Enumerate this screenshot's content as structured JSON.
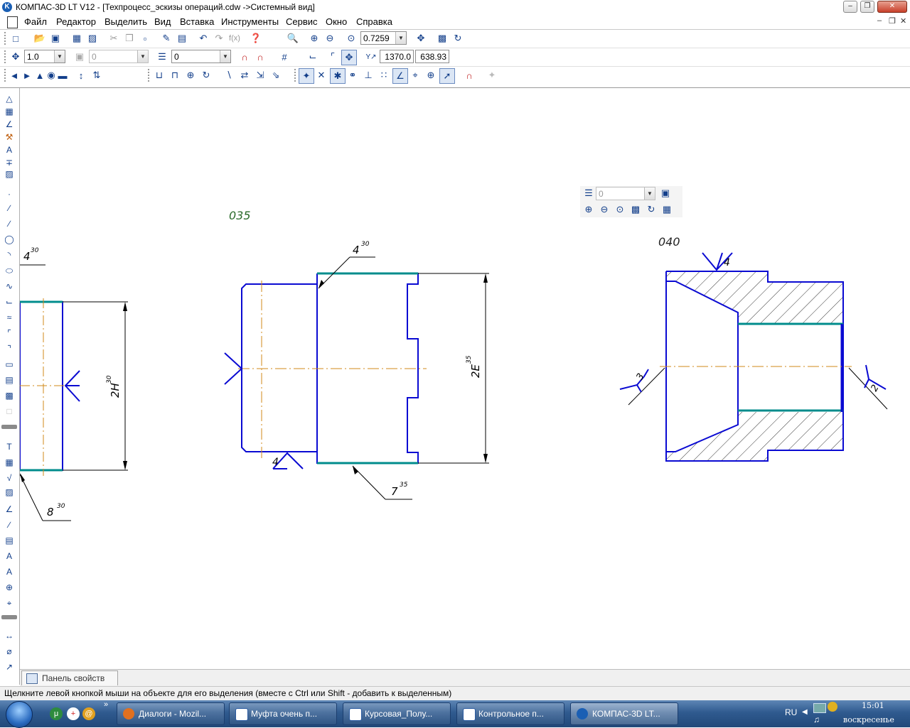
{
  "window": {
    "title": "КОМПАС-3D LT V12 - [Техпроцесс_эскизы операций.cdw ->Системный вид]",
    "app_icon": "K",
    "controls": [
      "minimize-icon",
      "restore-icon",
      "close-icon"
    ]
  },
  "menu": {
    "items": [
      "Файл",
      "Редактор",
      "Выделить",
      "Вид",
      "Вставка",
      "Инструменты",
      "Сервис",
      "Окно",
      "Справка"
    ]
  },
  "toolbar1": {
    "zoom_value": "0.7259"
  },
  "toolbar2": {
    "step_value": "1.0",
    "layer_value": "0",
    "style_value": "0",
    "coord_x": "1370.0",
    "coord_y": "638.93"
  },
  "float_panel": {
    "layer_value": "0"
  },
  "drawing": {
    "labels": {
      "op_035": "035",
      "op_040": "040",
      "left_rough": "4",
      "left_rough_sup": "30",
      "left_dim": "2Н",
      "left_dim_sup": "30",
      "left_leader": "8",
      "left_leader_sup": "30",
      "mid_top": "4",
      "mid_top_sup": "30",
      "mid_dim": "2Е",
      "mid_dim_sup": "35",
      "mid_bottom": "7",
      "mid_bottom_sup": "35",
      "mid_support": "4",
      "right_top": "4",
      "right_left": "3",
      "right_right": "2"
    },
    "colors": {
      "part": "#0a0ad2",
      "surface": "#008c8c",
      "axis": "#d08a1a",
      "dim": "#000000",
      "label": "#2a6a2a"
    }
  },
  "property_panel": {
    "tab_label": "Панель свойств"
  },
  "status": {
    "hint": "Щелкните левой кнопкой мыши на объекте для его выделения (вместе с Ctrl или Shift - добавить к выделенным)"
  },
  "taskbar": {
    "tasks": [
      "Диалоги - Mozil...",
      "Муфта очень п...",
      "Курсовая_Полу...",
      "Контрольное п...",
      "КОМПАС-3D LT..."
    ],
    "lang": "RU",
    "time": "15:01",
    "day": "воскресенье"
  }
}
